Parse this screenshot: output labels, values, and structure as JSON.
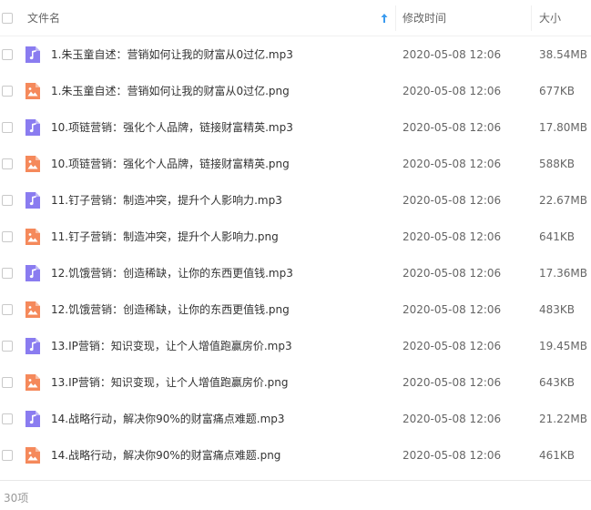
{
  "header": {
    "name_label": "文件名",
    "time_label": "修改时间",
    "size_label": "大小",
    "sort_icon": "arrow-up-icon"
  },
  "colors": {
    "audio_icon": "#8a7cf0",
    "image_icon": "#f5895b",
    "sort_arrow": "#3b9bef"
  },
  "files": [
    {
      "name": "1.朱玉童自述：营销如何让我的财富从0过亿.mp3",
      "time": "2020-05-08 12:06",
      "size": "38.54MB",
      "type": "audio"
    },
    {
      "name": "1.朱玉童自述：营销如何让我的财富从0过亿.png",
      "time": "2020-05-08 12:06",
      "size": "677KB",
      "type": "image"
    },
    {
      "name": "10.项链营销：强化个人品牌，链接财富精英.mp3",
      "time": "2020-05-08 12:06",
      "size": "17.80MB",
      "type": "audio"
    },
    {
      "name": "10.项链营销：强化个人品牌，链接财富精英.png",
      "time": "2020-05-08 12:06",
      "size": "588KB",
      "type": "image"
    },
    {
      "name": "11.钉子营销：制造冲突，提升个人影响力.mp3",
      "time": "2020-05-08 12:06",
      "size": "22.67MB",
      "type": "audio"
    },
    {
      "name": "11.钉子营销：制造冲突，提升个人影响力.png",
      "time": "2020-05-08 12:06",
      "size": "641KB",
      "type": "image"
    },
    {
      "name": "12.饥饿营销：创造稀缺，让你的东西更值钱.mp3",
      "time": "2020-05-08 12:06",
      "size": "17.36MB",
      "type": "audio"
    },
    {
      "name": "12.饥饿营销：创造稀缺，让你的东西更值钱.png",
      "time": "2020-05-08 12:06",
      "size": "483KB",
      "type": "image"
    },
    {
      "name": "13.IP营销：知识变现，让个人增值跑赢房价.mp3",
      "time": "2020-05-08 12:06",
      "size": "19.45MB",
      "type": "audio"
    },
    {
      "name": "13.IP营销：知识变现，让个人增值跑赢房价.png",
      "time": "2020-05-08 12:06",
      "size": "643KB",
      "type": "image"
    },
    {
      "name": "14.战略行动，解决你90%的财富痛点难题.mp3",
      "time": "2020-05-08 12:06",
      "size": "21.22MB",
      "type": "audio"
    },
    {
      "name": "14.战略行动，解决你90%的财富痛点难题.png",
      "time": "2020-05-08 12:06",
      "size": "461KB",
      "type": "image"
    }
  ],
  "footer": {
    "count": "30项"
  }
}
